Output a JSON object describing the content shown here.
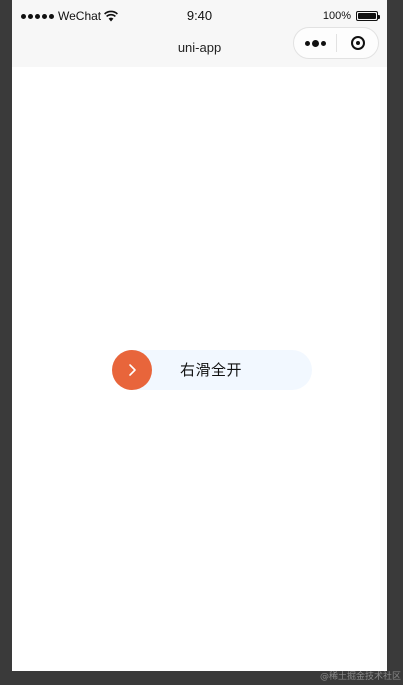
{
  "status_bar": {
    "carrier": "WeChat",
    "time": "9:40",
    "battery_percent": "100%",
    "signal_icon": "signal-dots-icon",
    "wifi_icon": "wifi-icon",
    "battery_icon": "battery-icon"
  },
  "nav_bar": {
    "title": "uni-app",
    "more_icon": "more-dots-icon",
    "close_icon": "target-circle-icon"
  },
  "slider": {
    "label": "右滑全开",
    "handle_icon": "chevron-right-icon",
    "progress": 0,
    "handle_color": "#e8653b",
    "track_color": "#f2f8ff"
  },
  "watermark": {
    "text": "@稀土掘金技术社区"
  }
}
